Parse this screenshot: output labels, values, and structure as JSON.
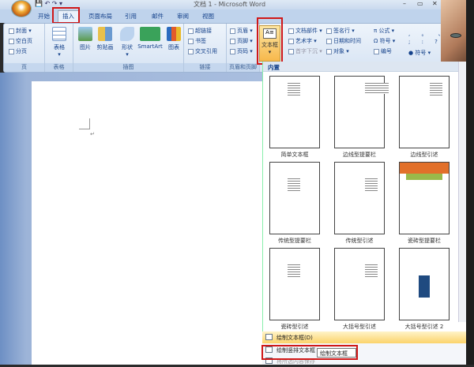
{
  "window": {
    "title": "文档 1 - Microsoft Word",
    "minimize": "–",
    "maximize": "▭",
    "close": "✕"
  },
  "tabs": [
    "开始",
    "插入",
    "页面布局",
    "引用",
    "邮件",
    "审阅",
    "视图"
  ],
  "ribbon": {
    "pages": {
      "label": "页",
      "items": [
        "封面",
        "空白页",
        "分页"
      ]
    },
    "table": {
      "label": "表格",
      "button": "表格"
    },
    "illustrations": {
      "label": "插图",
      "items": [
        "图片",
        "剪贴画",
        "形状",
        "SmartArt",
        "图表"
      ]
    },
    "links": {
      "label": "链接",
      "items": [
        "超链接",
        "书签",
        "交叉引用"
      ]
    },
    "header_footer": {
      "label": "页眉和页脚",
      "items": [
        "页眉",
        "页脚",
        "页码"
      ]
    },
    "text": {
      "textbox": "文本框",
      "items": [
        "文档部件",
        "艺术字",
        "首字下沉",
        "签名行",
        "日期和时间",
        "对象"
      ]
    },
    "symbols": {
      "items": [
        "公式",
        "符号",
        "编号"
      ]
    },
    "special": {
      "items": [
        "符号"
      ]
    }
  },
  "gallery": {
    "header": "内置",
    "items": [
      "简单文本框",
      "边线型提要栏",
      "边线型引述",
      "传统型提要栏",
      "传统型引述",
      "瓷砖型提要栏",
      "瓷砖型引述",
      "大括号型引述",
      "大括号型引述 2"
    ]
  },
  "menu": {
    "items": [
      "绘制文本框(D)",
      "绘制竖排文本框",
      "将所选内容保存"
    ]
  },
  "tooltip": "绘制文本框",
  "document": {
    "paragraph_mark": "↵"
  }
}
